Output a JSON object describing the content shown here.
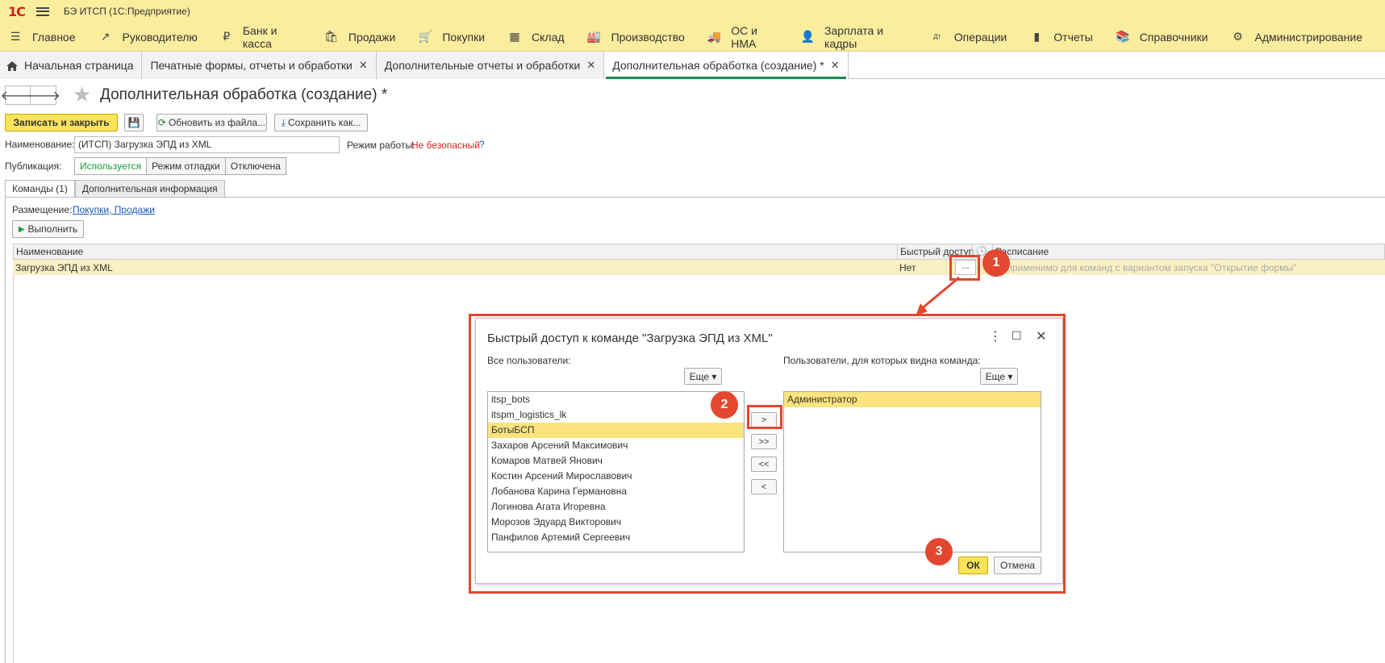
{
  "topbar": {
    "logo": "1С",
    "title": "БЭ ИТСП  (1С:Предприятие)"
  },
  "menu": [
    {
      "label": "Главное",
      "icon": "☰",
      "icon_name": "hamburger-icon"
    },
    {
      "label": "Руководителю",
      "icon": "↗",
      "icon_name": "trend-icon"
    },
    {
      "label": "Банк и касса",
      "icon": "₽",
      "icon_name": "ruble-icon"
    },
    {
      "label": "Продажи",
      "icon": "🛍",
      "icon_name": "bag-icon"
    },
    {
      "label": "Покупки",
      "icon": "🛒",
      "icon_name": "cart-icon"
    },
    {
      "label": "Склад",
      "icon": "▦",
      "icon_name": "warehouse-icon"
    },
    {
      "label": "Производство",
      "icon": "🏭",
      "icon_name": "factory-icon"
    },
    {
      "label": "ОС и НМА",
      "icon": "🚚",
      "icon_name": "truck-icon"
    },
    {
      "label": "Зарплата и кадры",
      "icon": "👤",
      "icon_name": "person-icon"
    },
    {
      "label": "Операции",
      "icon": "Дт",
      "icon_name": "debit-credit-icon"
    },
    {
      "label": "Отчеты",
      "icon": "▮",
      "icon_name": "bar-chart-icon"
    },
    {
      "label": "Справочники",
      "icon": "📚",
      "icon_name": "books-icon"
    },
    {
      "label": "Администрирование",
      "icon": "⚙",
      "icon_name": "gear-icon"
    }
  ],
  "tabs": [
    {
      "label": "Начальная страница",
      "home": true,
      "closable": false,
      "active": false
    },
    {
      "label": "Печатные формы, отчеты и обработки",
      "closable": true,
      "active": false
    },
    {
      "label": "Дополнительные отчеты и обработки",
      "closable": true,
      "active": false
    },
    {
      "label": "Дополнительная обработка (создание) *",
      "closable": true,
      "active": true
    }
  ],
  "tab_close_glyph": "✕",
  "nav": {
    "back": "🡐",
    "forward": "🡒",
    "star": "★"
  },
  "page": {
    "title": "Дополнительная обработка (создание) *"
  },
  "toolbar": {
    "save_close": "Записать и закрыть",
    "disk": "💾",
    "update_file": "Обновить из файла...",
    "update_icon": "⟳",
    "save_as": "Сохранить как...",
    "save_as_icon": "⤓"
  },
  "form": {
    "name_label": "Наименование:",
    "name_value": "(ИТСП) Загрузка ЭПД из XML",
    "mode_label": "Режим работы:",
    "mode_value": "Не безопасный",
    "help": "?",
    "pub_label": "Публикация:",
    "pub_options": [
      "Используется",
      "Режим отладки",
      "Отключена"
    ]
  },
  "ptabs": [
    "Команды (1)",
    "Дополнительная информация"
  ],
  "placement": {
    "label": "Размещение:",
    "value": "Покупки, Продажи"
  },
  "run": {
    "icon": "▶",
    "label": "Выполнить"
  },
  "grid": {
    "columns": [
      "Наименование",
      "Быстрый доступ",
      "Расписание"
    ],
    "clock": "🕓",
    "row": {
      "name": "Загрузка ЭПД из XML",
      "quick": "Нет",
      "dots": "...",
      "schedule": "Неприменимо для команд с вариантом запуска \"Открытие формы\""
    }
  },
  "callouts": [
    "1",
    "2",
    "3"
  ],
  "dialog": {
    "title": "Быстрый доступ к команде \"Загрузка ЭПД из XML\"",
    "more_glyph": "⋮",
    "max_glyph": "☐",
    "close_glyph": "✕",
    "left_label": "Все пользователи:",
    "right_label": "Пользователи, для которых видна команда:",
    "more_btn": "Еще ▾",
    "left_users": [
      "itsp_bots",
      "itspm_logistics_lk",
      "БотыБСП",
      "Захаров Арсений Максимович",
      "Комаров Матвей Янович",
      "Костин Арсений Мирославович",
      "Лобанова Карина Германовна",
      "Логинова Агата Игоревна",
      "Морозов Эдуард Викторович",
      "Панфилов Артемий Сергеевич"
    ],
    "right_users": [
      "Администратор"
    ],
    "move_buttons": [
      ">",
      ">>",
      "<<",
      "<"
    ],
    "ok": "ОК",
    "cancel": "Отмена"
  }
}
